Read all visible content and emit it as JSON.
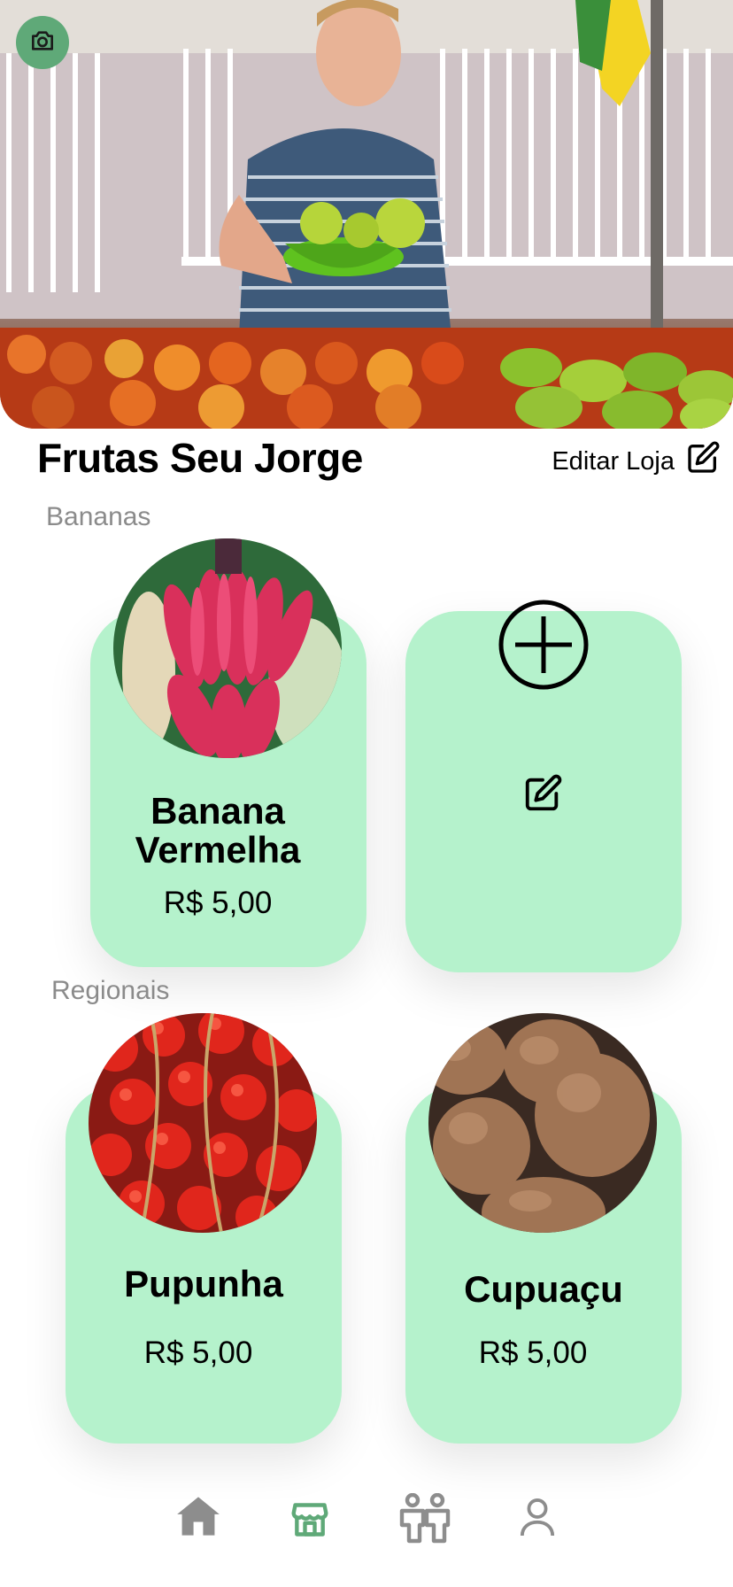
{
  "store": {
    "name": "Frutas Seu Jorge",
    "edit_label": "Editar Loja"
  },
  "sections": [
    {
      "label": "Bananas",
      "products": [
        {
          "name": "Banana Vermelha",
          "price": "R$ 5,00"
        }
      ]
    },
    {
      "label": "Regionais",
      "products": [
        {
          "name": "Pupunha",
          "price": "R$ 5,00"
        },
        {
          "name": "Cupuaçu",
          "price": "R$ 5,00"
        }
      ]
    }
  ],
  "icons": {
    "camera": "camera-icon",
    "edit": "edit-icon",
    "add": "plus-circle-icon",
    "nav": [
      "home-icon",
      "store-icon",
      "people-icon",
      "profile-icon"
    ]
  },
  "colors": {
    "card": "#b5f2cc",
    "camera_bg": "#5fa978",
    "nav_active": "#5fa978",
    "nav_inactive": "#8d8d8d",
    "section_label": "#8b8b8b"
  },
  "nav": {
    "active_index": 1
  }
}
